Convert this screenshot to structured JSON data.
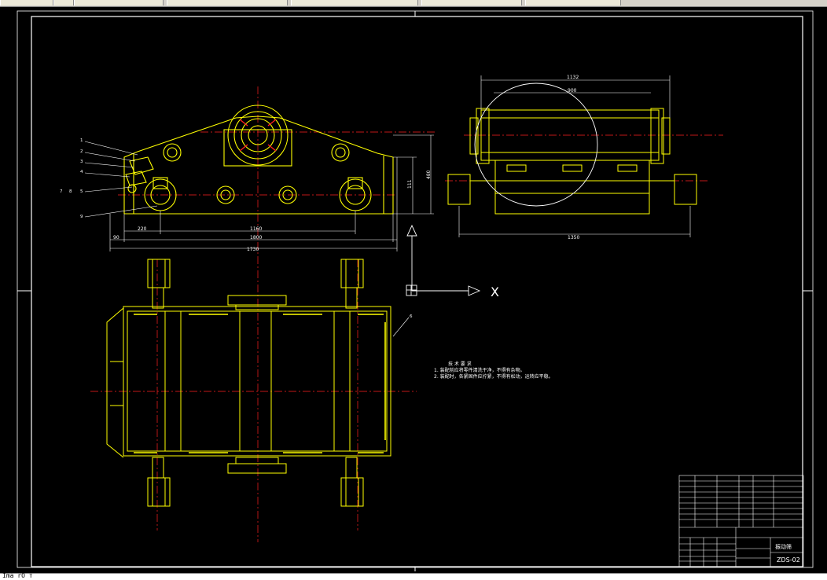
{
  "colors": {
    "background": "#000000",
    "geometry": "#ffff00",
    "centerline": "#ff2020",
    "frame": "#ffffff",
    "dimension": "#ffffff"
  },
  "command_line": {
    "text": "Ima  rO т"
  },
  "drawing": {
    "dimensions": {
      "overall_length": "1730",
      "inner_length": "1800",
      "center_span": "1160",
      "left_offset": "220",
      "edge_offset": "90",
      "height_total": "480",
      "height_partial": "111",
      "top_width": "1132",
      "inner_width": "900",
      "base_width": "1350"
    },
    "part_labels": [
      "1",
      "2",
      "3",
      "4",
      "5",
      "7",
      "8",
      "9",
      "6"
    ],
    "axis_label": "X",
    "notes": {
      "title": "技 术 要 求",
      "line1": "1.  装配前应将零件清洗干净，不得有杂物。",
      "line2": "2.  装配时，各紧固件应拧紧，不得有松动，运转应平稳。"
    },
    "title_block": {
      "drawing_name": "振动筛",
      "drawing_number": "ZDS-02"
    }
  }
}
